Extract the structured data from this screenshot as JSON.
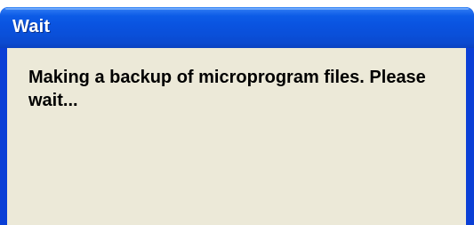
{
  "dialog": {
    "title": "Wait",
    "message": "Making a backup of microprogram files. Please wait..."
  },
  "colors": {
    "titlebar": "#0a53e0",
    "frame": "#0a3fd6",
    "client_background": "#ece9d8",
    "title_text": "#ffffff",
    "message_text": "#000000"
  }
}
